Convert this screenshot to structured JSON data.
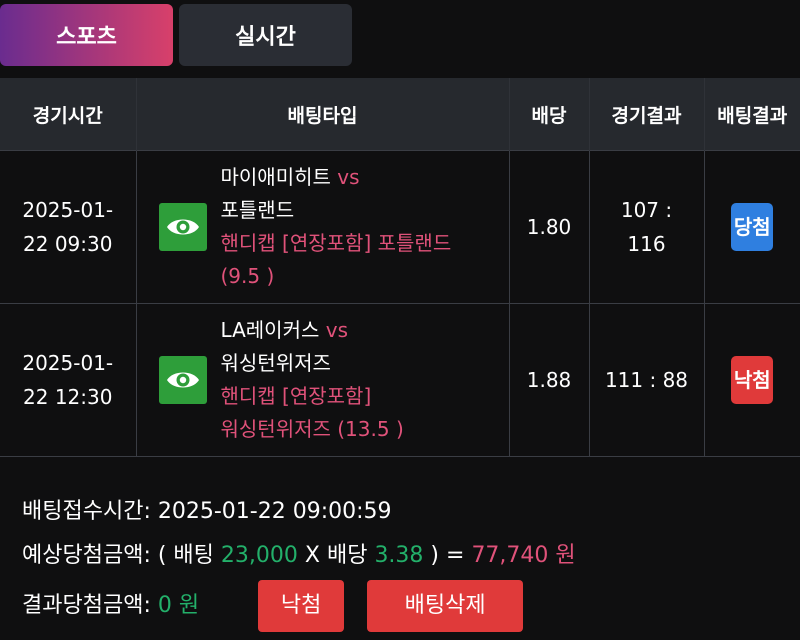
{
  "tabs": {
    "sports": "스포츠",
    "live": "실시간"
  },
  "table": {
    "headers": [
      "경기시간",
      "배팅타입",
      "배당",
      "경기결과",
      "배팅결과"
    ],
    "rows": [
      {
        "time_date": "2025-01-",
        "time_clock": "22 09:30",
        "home": "마이애미히트",
        "vs": "vs",
        "away": "포틀랜드",
        "bet_line1": "핸디캡 [연장포함] 포틀랜드",
        "bet_line2": "(9.5 )",
        "odds": "1.80",
        "score_line1": "107 :",
        "score_line2": "116",
        "result": "당첨",
        "result_color": "#2f7fe0"
      },
      {
        "time_date": "2025-01-",
        "time_clock": "22 12:30",
        "home": "LA레이커스",
        "vs": "vs",
        "away": "워싱턴위저즈",
        "bet_line1": "핸디캡 [연장포함]",
        "bet_line2": "워싱턴위저즈 (13.5 )",
        "odds": "1.88",
        "score": "111 : 88",
        "result": "낙첨",
        "result_color": "#e03a3a"
      }
    ]
  },
  "summary": {
    "bet_time_label": "배팅접수시간:",
    "bet_time_value": "2025-01-22 09:00:59",
    "expected_label": "예상당첨금액: ( 배팅",
    "bet_amount": "23,000",
    "x_label": "X 배당",
    "total_odds": "3.38",
    "eq_label": ") =",
    "expected_amount": "77,740 원",
    "result_label": "결과당첨금액:",
    "result_amount": "0 원",
    "lose_button": "낙첨",
    "delete_button": "배팅삭제"
  },
  "icons": {
    "eye": "eye-icon"
  },
  "colors": {
    "accent_green": "#23b06a",
    "accent_pink": "#e0527a",
    "win_blue": "#2f7fe0",
    "lose_red": "#e03a3a"
  }
}
